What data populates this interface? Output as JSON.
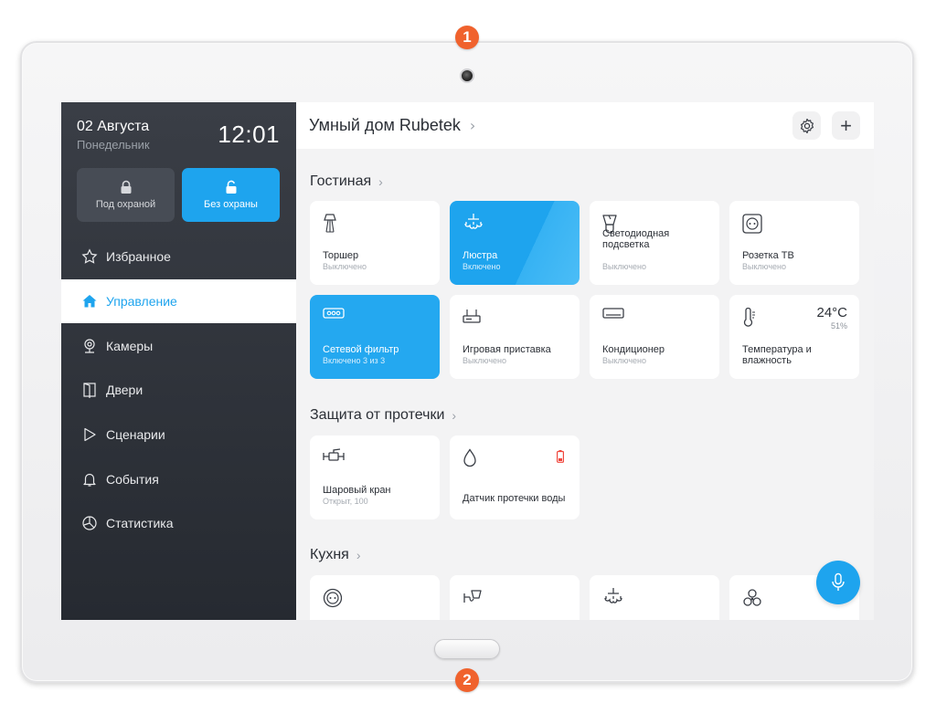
{
  "callouts": [
    "1",
    "2"
  ],
  "sidebar": {
    "date": "02 Августа",
    "weekday": "Понедельник",
    "time": "12:01",
    "security": {
      "armed_label": "Под охраной",
      "disarmed_label": "Без охраны"
    },
    "nav": [
      {
        "label": "Избранное",
        "icon": "star-icon"
      },
      {
        "label": "Управление",
        "icon": "home-icon",
        "active": true
      },
      {
        "label": "Камеры",
        "icon": "camera-icon"
      },
      {
        "label": "Двери",
        "icon": "door-icon"
      },
      {
        "label": "Сценарии",
        "icon": "play-icon"
      },
      {
        "label": "События",
        "icon": "bell-icon"
      },
      {
        "label": "Статистика",
        "icon": "chart-icon"
      }
    ]
  },
  "header": {
    "title": "Умный дом Rubetek",
    "chevron": "›",
    "add_label": "+"
  },
  "sections": {
    "living_room": {
      "title": "Гостиная",
      "tiles": [
        {
          "name": "Торшер",
          "status": "Выключено"
        },
        {
          "name": "Люстра",
          "status": "Включено"
        },
        {
          "name": "Светодиодная подсветка",
          "status": "Выключено"
        },
        {
          "name": "Розетка ТВ",
          "status": "Выключено"
        },
        {
          "name": "Сетевой фильтр",
          "status": "Включено 3 из 3"
        },
        {
          "name": "Игровая приставка",
          "status": "Выключено"
        },
        {
          "name": "Кондиционер",
          "status": "Выключено"
        },
        {
          "name": "Температура и влажность",
          "temperature": "24°C",
          "humidity": "51%"
        }
      ]
    },
    "leak": {
      "title": "Защита от протечки",
      "tiles": [
        {
          "name": "Шаровый кран",
          "status": "Открыт, 100"
        },
        {
          "name": "Датчик протечки воды"
        }
      ]
    },
    "kitchen": {
      "title": "Кухня"
    }
  },
  "colors": {
    "accent": "#1ea4ee",
    "sidebar": "#2f333a",
    "callout": "#f0622d",
    "battery_low": "#f0463c"
  }
}
